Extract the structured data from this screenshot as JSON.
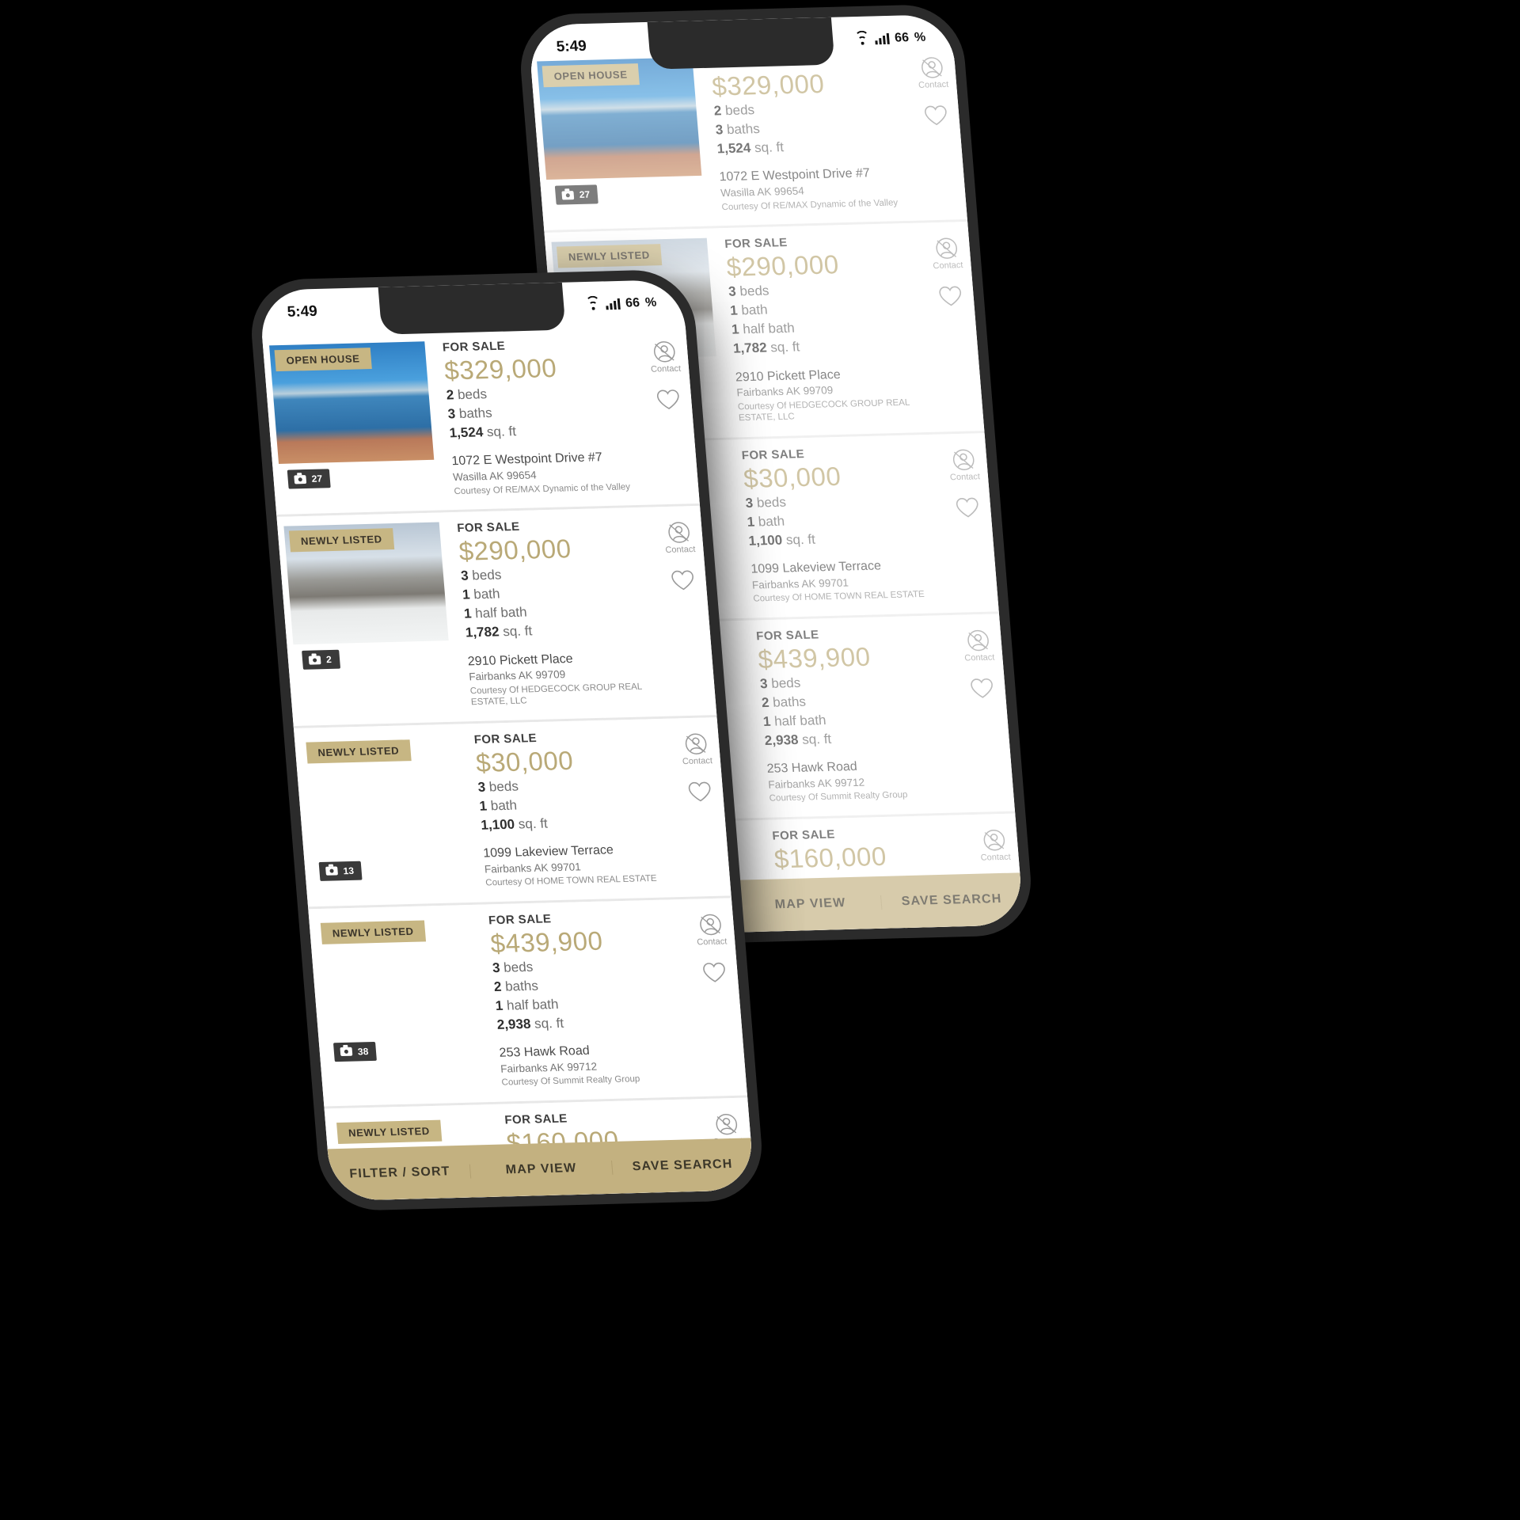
{
  "app": {
    "status_bar": {
      "time": "5:49",
      "battery": "66",
      "wifi_icon": "wifi-icon",
      "signal_icon": "signal-bars-icon"
    },
    "bottom_bar": {
      "filter_sort": "FILTER / SORT",
      "map_view": "MAP VIEW",
      "save_search": "SAVE SEARCH"
    },
    "action_icons": {
      "contact_label": "Contact",
      "contact_icon": "contact-person-icon",
      "favorite_icon": "heart-icon"
    },
    "ribbons": {
      "open_house": "OPEN HOUSE",
      "newly_listed": "NEWLY LISTED"
    },
    "status_label": "FOR SALE",
    "photo_icon": "camera-icon"
  },
  "colors": {
    "accent_gold": "#c3b180",
    "price_gold": "#b9a977",
    "ribbon_gold": "#c7b683",
    "frame_black": "#2b2b2b",
    "text_dark": "#3d3d3d"
  },
  "listings": [
    {
      "ribbon": "OPEN HOUSE",
      "ribbon_type": "open-house",
      "photo_count": "27",
      "status": "FOR SALE",
      "price": "$329,000",
      "specs": [
        {
          "value": "2",
          "unit": "beds"
        },
        {
          "value": "3",
          "unit": "baths"
        },
        {
          "value": "1,524",
          "unit": "sq. ft"
        }
      ],
      "address": "1072 E Westpoint Drive #7",
      "city_state_zip": "Wasilla AK 99654",
      "courtesy": "Courtesy Of RE/MAX Dynamic of the Valley",
      "photo_theme": "lake-mountains"
    },
    {
      "ribbon": "NEWLY LISTED",
      "ribbon_type": "newly-listed",
      "photo_count": "2",
      "status": "FOR SALE",
      "price": "$290,000",
      "specs": [
        {
          "value": "3",
          "unit": "beds"
        },
        {
          "value": "1",
          "unit": "bath"
        },
        {
          "value": "1",
          "unit": "half bath"
        },
        {
          "value": "1,782",
          "unit": "sq. ft"
        }
      ],
      "address": "2910 Pickett Place",
      "city_state_zip": "Fairbanks AK 99709",
      "courtesy": "Courtesy Of HEDGECOCK GROUP REAL ESTATE, LLC",
      "photo_theme": "snow-house"
    },
    {
      "ribbon": "NEWLY LISTED",
      "ribbon_type": "newly-listed",
      "photo_count": "13",
      "status": "FOR SALE",
      "price": "$30,000",
      "specs": [
        {
          "value": "3",
          "unit": "beds"
        },
        {
          "value": "1",
          "unit": "bath"
        },
        {
          "value": "1,100",
          "unit": "sq. ft"
        }
      ],
      "address": "1099 Lakeview Terrace",
      "city_state_zip": "Fairbanks AK 99701",
      "courtesy": "Courtesy Of HOME TOWN REAL ESTATE",
      "photo_theme": "blank-blue"
    },
    {
      "ribbon": "NEWLY LISTED",
      "ribbon_type": "newly-listed",
      "photo_count": "38",
      "status": "FOR SALE",
      "price": "$439,900",
      "specs": [
        {
          "value": "3",
          "unit": "beds"
        },
        {
          "value": "2",
          "unit": "baths"
        },
        {
          "value": "1",
          "unit": "half bath"
        },
        {
          "value": "2,938",
          "unit": "sq. ft"
        }
      ],
      "address": "253 Hawk Road",
      "city_state_zip": "Fairbanks AK 99712",
      "courtesy": "Courtesy Of Summit Realty Group",
      "photo_theme": "snow-cabin"
    },
    {
      "ribbon": "NEWLY LISTED",
      "ribbon_type": "newly-listed",
      "photo_count": "",
      "status": "FOR SALE",
      "price": "$160,000",
      "specs": [],
      "address": "",
      "city_state_zip": "",
      "courtesy": "",
      "photo_theme": "blank"
    }
  ]
}
